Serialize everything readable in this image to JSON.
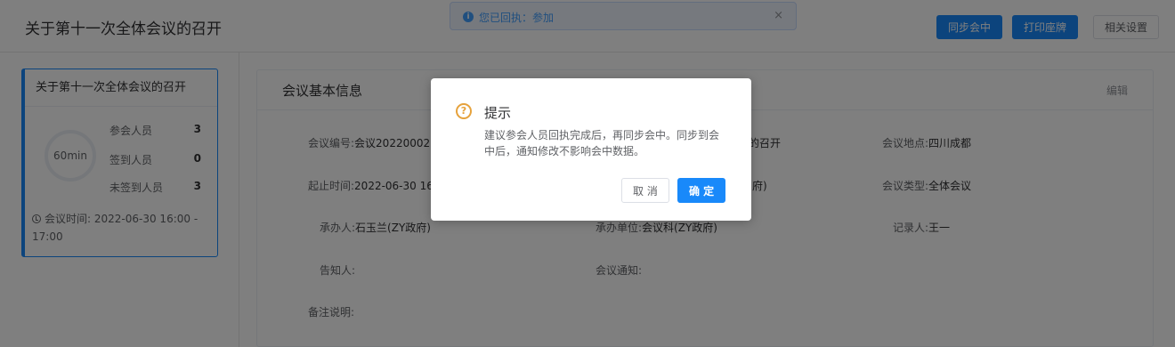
{
  "header": {
    "title": "关于第十一次全体会议的召开",
    "buttons": {
      "sync": "同步会中",
      "print": "打印座牌",
      "settings": "相关设置"
    }
  },
  "toast": {
    "icon": "info-icon",
    "text": "您已回执：参加",
    "close": "×"
  },
  "sidebar": {
    "card": {
      "title": "关于第十一次全体会议的召开",
      "duration": "60min",
      "stats": [
        {
          "label": "参会人员",
          "value": "3"
        },
        {
          "label": "签到人员",
          "value": "0"
        },
        {
          "label": "未签到人员",
          "value": "3"
        }
      ],
      "time_label": "会议时间:",
      "time_value": "2022-06-30 16:00 - 17:00"
    }
  },
  "info": {
    "title": "会议基本信息",
    "edit": "编辑",
    "fields": [
      {
        "label": "会议编号:",
        "value": "会议20220002"
      },
      {
        "label": "",
        "value": "议的召开"
      },
      {
        "label": "会议地点:",
        "value": "四川成都"
      },
      {
        "label": "起止时间:",
        "value": "2022-06-30 16"
      },
      {
        "label": "",
        "value": "府)"
      },
      {
        "label": "会议类型:",
        "value": "全体会议"
      },
      {
        "label": "承办人:",
        "value": "石玉兰(ZY政府)"
      },
      {
        "label": "承办单位:",
        "value": "会议科(ZY政府)"
      },
      {
        "label": "记录人:",
        "value": "王一"
      },
      {
        "label": "告知人:",
        "value": ""
      },
      {
        "label": "会议通知:",
        "value": ""
      },
      {
        "label": "备注说明:",
        "value": ""
      }
    ]
  },
  "dialog": {
    "icon": "question-icon",
    "icon_glyph": "?",
    "title": "提示",
    "message": "建议参会人员回执完成后，再同步会中。同步到会中后，通知修改不影响会中数据。",
    "cancel": "取 消",
    "confirm": "确 定"
  },
  "colors": {
    "primary": "#1989fa",
    "warning": "#e6a23c",
    "mask": "rgba(0,0,0,0.5)"
  }
}
